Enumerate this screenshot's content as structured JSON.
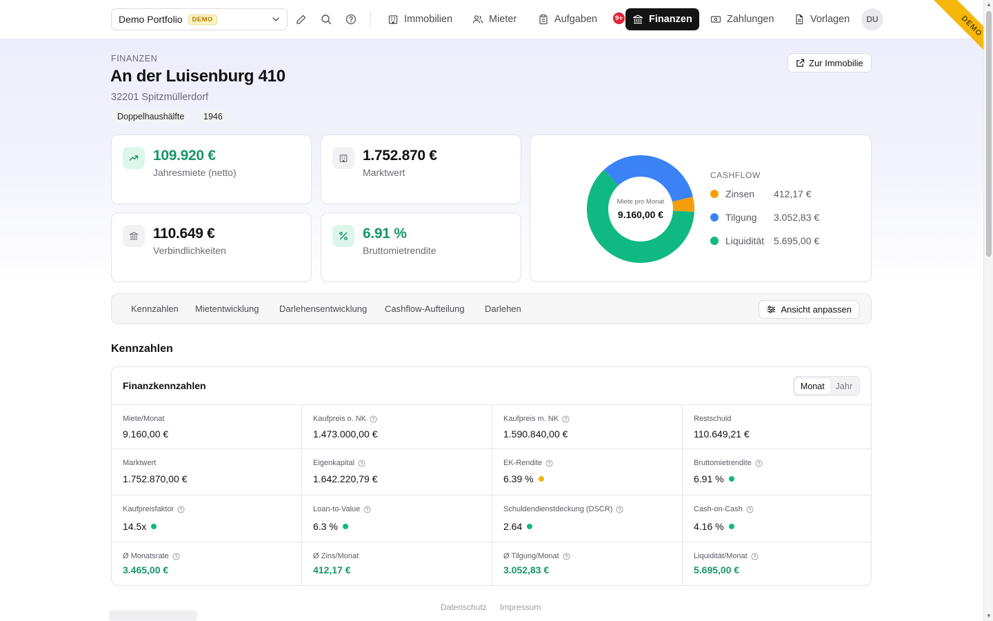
{
  "topbar": {
    "portfolio": "Demo Portfolio",
    "demo_badge": "DEMO",
    "nav": [
      {
        "label": "Immobilien",
        "icon": "building-icon"
      },
      {
        "label": "Mieter",
        "icon": "users-icon"
      },
      {
        "label": "Aufgaben",
        "icon": "clipboard-icon",
        "badge": "9+"
      },
      {
        "label": "Finanzen",
        "icon": "bank-icon",
        "active": true
      },
      {
        "label": "Zahlungen",
        "icon": "cash-icon"
      },
      {
        "label": "Vorlagen",
        "icon": "document-icon"
      }
    ],
    "avatar": "DU",
    "ribbon": "DEMO"
  },
  "header": {
    "kicker": "FINANZEN",
    "title": "An der Luisenburg 410",
    "address": "32201 Spitzmüllerdorf",
    "tags": [
      "Doppelhaushälfte",
      "1946"
    ],
    "zur_immobilie": "Zur Immobilie"
  },
  "kpis": [
    {
      "value": "109.920 €",
      "label": "Jahresmiete (netto)",
      "icon": "trending-up-icon",
      "tone": "green"
    },
    {
      "value": "1.752.870 €",
      "label": "Marktwert",
      "icon": "building-icon",
      "tone": "neutral"
    },
    {
      "value": "110.649 €",
      "label": "Verbindlichkeiten",
      "icon": "bank-icon",
      "tone": "neutral"
    },
    {
      "value": "6.91 %",
      "label": "Bruttomietrendite",
      "icon": "percent-icon",
      "tone": "green"
    }
  ],
  "cashflow": {
    "title": "CASHFLOW",
    "center_label": "Miete pro Monat",
    "center_value": "9.160,00 €",
    "items": [
      {
        "name": "Zinsen",
        "amount": "412,17 €",
        "value": 412.17,
        "color": "#f59e0b"
      },
      {
        "name": "Tilgung",
        "amount": "3.052,83 €",
        "value": 3052.83,
        "color": "#3b82f6"
      },
      {
        "name": "Liquidität",
        "amount": "5.695,00 €",
        "value": 5695.0,
        "color": "#10b981"
      }
    ]
  },
  "tabs": [
    "Kennzahlen",
    "Mietentwicklung",
    "Darlehensentwicklung",
    "Cashflow-Aufteilung",
    "Darlehen"
  ],
  "ansicht_button": "Ansicht anpassen",
  "section_title": "Kennzahlen",
  "finanz": {
    "title": "Finanzkennzahlen",
    "toggle": [
      "Monat",
      "Jahr"
    ],
    "rows": [
      [
        {
          "label": "Miete/Monat",
          "value": "9.160,00 €",
          "help": false
        },
        {
          "label": "Kaufpreis o. NK",
          "value": "1.473.000,00 €",
          "help": true
        },
        {
          "label": "Kaufpreis m. NK",
          "value": "1.590.840,00 €",
          "help": true
        },
        {
          "label": "Restschuld",
          "value": "110.649,21 €",
          "help": false
        }
      ],
      [
        {
          "label": "Marktwert",
          "value": "1.752.870,00 €",
          "help": false
        },
        {
          "label": "Eigenkapital",
          "value": "1.642.220,79 €",
          "help": true
        },
        {
          "label": "EK-Rendite",
          "value": "6.39 %",
          "help": true,
          "status": "#f5b70a"
        },
        {
          "label": "Bruttomietrendite",
          "value": "6.91 %",
          "help": true,
          "status": "#10b981"
        }
      ],
      [
        {
          "label": "Kaufpreisfaktor",
          "value": "14.5x",
          "help": true,
          "status": "#10b981"
        },
        {
          "label": "Loan-to-Value",
          "value": "6.3 %",
          "help": true,
          "status": "#10b981"
        },
        {
          "label": "Schuldendienstdeckung (DSCR)",
          "value": "2.64",
          "help": true,
          "status": "#10b981"
        },
        {
          "label": "Cash-on-Cash",
          "value": "4.16 %",
          "help": true,
          "status": "#10b981"
        }
      ],
      [
        {
          "label": "Ø Monatsrate",
          "value": "3.465,00 €",
          "help": true,
          "green": true
        },
        {
          "label": "Ø Zins/Monat",
          "value": "412,17 €",
          "help": false,
          "green": true
        },
        {
          "label": "Ø Tilgung/Monat",
          "value": "3.052,83 €",
          "help": true,
          "green": true
        },
        {
          "label": "Liquidität/Monat",
          "value": "5.695,00 €",
          "help": true,
          "green": true
        }
      ]
    ]
  },
  "footer": [
    "Datenschutz",
    "Impressum"
  ]
}
